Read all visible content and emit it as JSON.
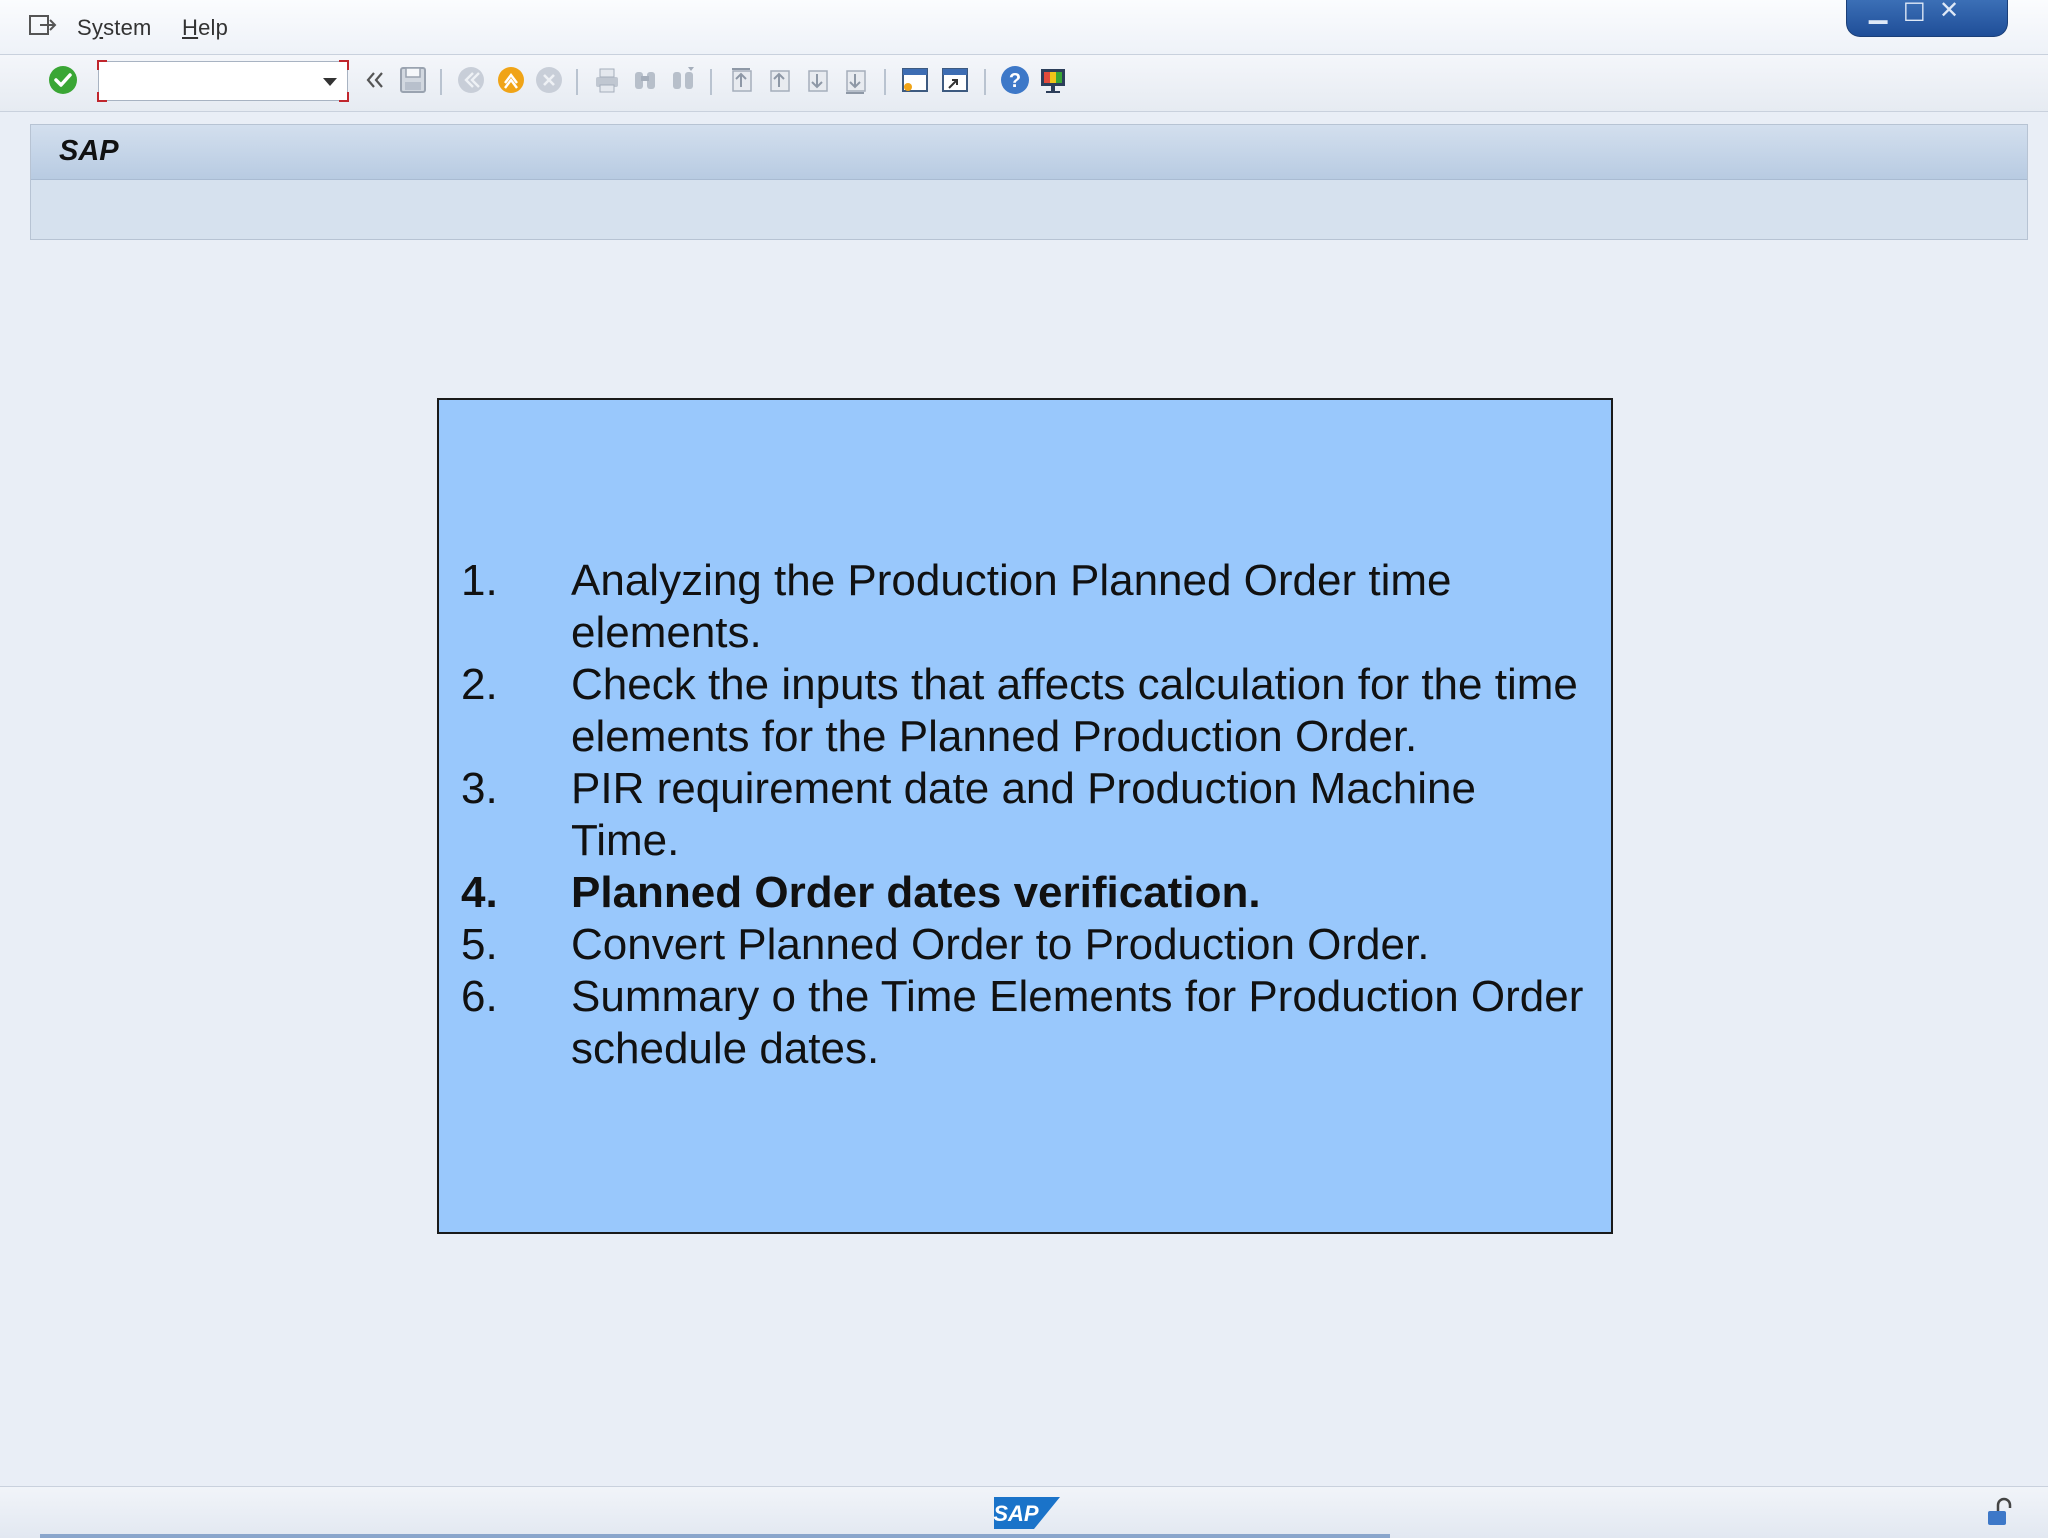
{
  "menubar": {
    "items": [
      {
        "label_pre": "S",
        "label_ul": "y",
        "label_post": "stem"
      },
      {
        "label_pre": "",
        "label_ul": "H",
        "label_post": "elp"
      }
    ]
  },
  "toolbar": {
    "command_field_value": "",
    "icons": [
      "enter-icon",
      "back-icon",
      "save-icon",
      "back-nav-icon",
      "exit-icon",
      "cancel-icon",
      "print-icon",
      "find-icon",
      "find-next-icon",
      "first-page-icon",
      "previous-page-icon",
      "next-page-icon",
      "last-page-icon",
      "create-session-icon",
      "shortcut-icon",
      "help-icon",
      "customize-layout-icon"
    ]
  },
  "header": {
    "title": "SAP"
  },
  "slide": {
    "items": [
      {
        "num": "1.",
        "text": "Analyzing the Production Planned Order time elements.",
        "bold": false
      },
      {
        "num": "2.",
        "text": "Check the inputs that affects calculation for the time elements for the Planned Production Order.",
        "bold": false
      },
      {
        "num": "3.",
        "text": "PIR requirement date and Production Machine Time.",
        "bold": false
      },
      {
        "num": "4.",
        "text": "Planned Order dates verification.",
        "bold": true
      },
      {
        "num": "5.",
        "text": "Convert Planned Order to Production Order.",
        "bold": false
      },
      {
        "num": "6.",
        "text": "Summary o the Time Elements for Production Order schedule dates.",
        "bold": false
      }
    ]
  },
  "statusbar": {
    "logo_text": "SAP"
  },
  "colors": {
    "slide_background": "#99c8fc",
    "screen_background": "#e9eef6",
    "enter_icon": "#3aa635",
    "sap_logo": "#1a73c9"
  }
}
